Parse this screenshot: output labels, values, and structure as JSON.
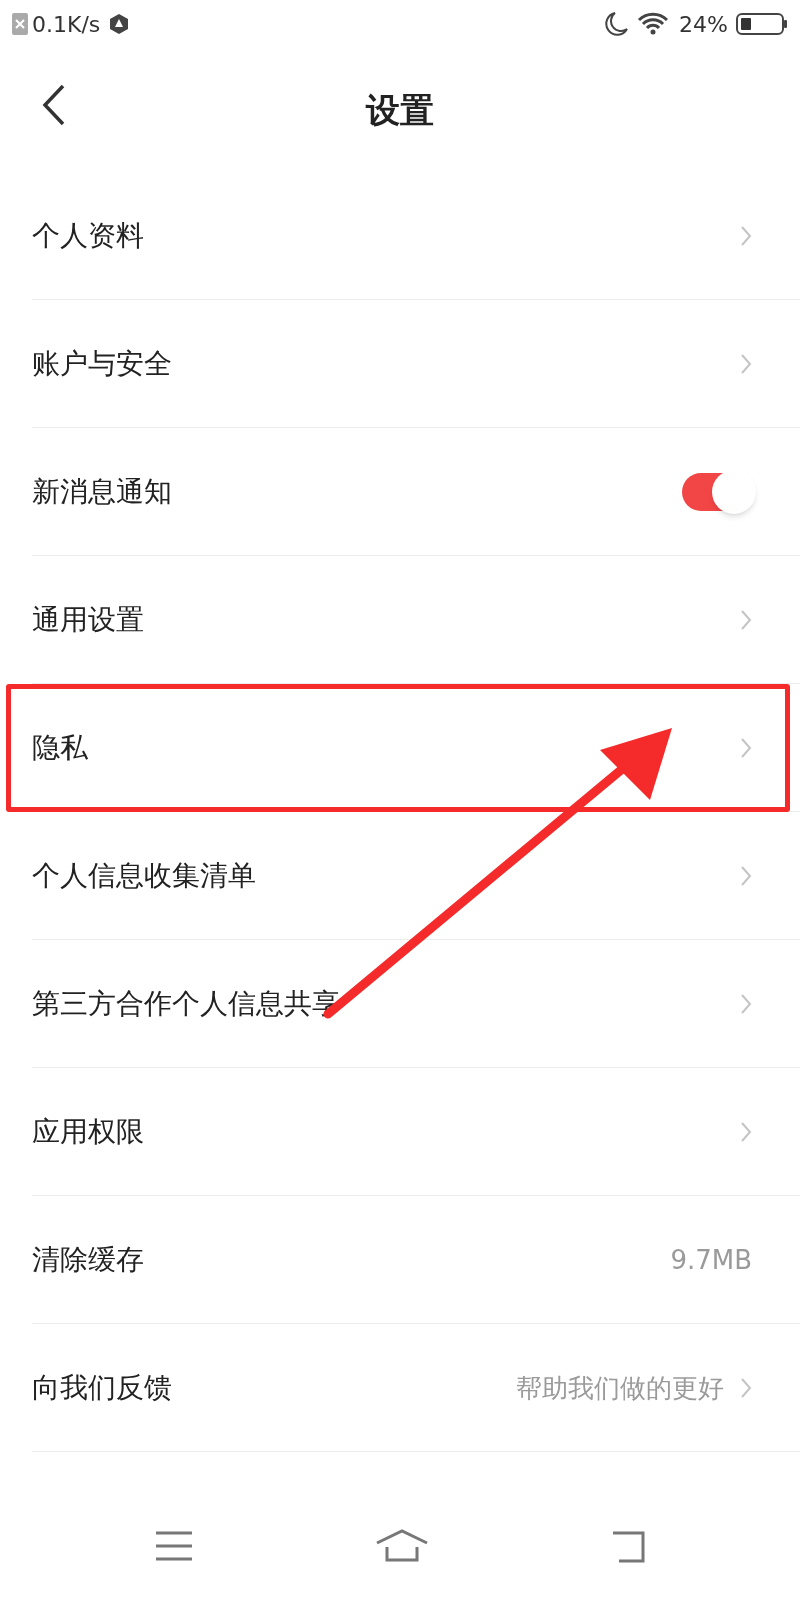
{
  "status_bar": {
    "speed": "0.1K/s",
    "battery": "24%"
  },
  "header": {
    "title": "设置"
  },
  "items": [
    {
      "kind": "link",
      "label": "个人资料"
    },
    {
      "kind": "link",
      "label": "账户与安全"
    },
    {
      "kind": "toggle",
      "label": "新消息通知",
      "on": true
    },
    {
      "kind": "link",
      "label": "通用设置"
    },
    {
      "kind": "link",
      "label": "隐私",
      "highlighted": true
    },
    {
      "kind": "link",
      "label": "个人信息收集清单"
    },
    {
      "kind": "link",
      "label": "第三方合作个人信息共享"
    },
    {
      "kind": "link",
      "label": "应用权限"
    },
    {
      "kind": "value",
      "label": "清除缓存",
      "value": "9.7MB"
    },
    {
      "kind": "link",
      "label": "向我们反馈",
      "value": "帮助我们做的更好"
    }
  ]
}
